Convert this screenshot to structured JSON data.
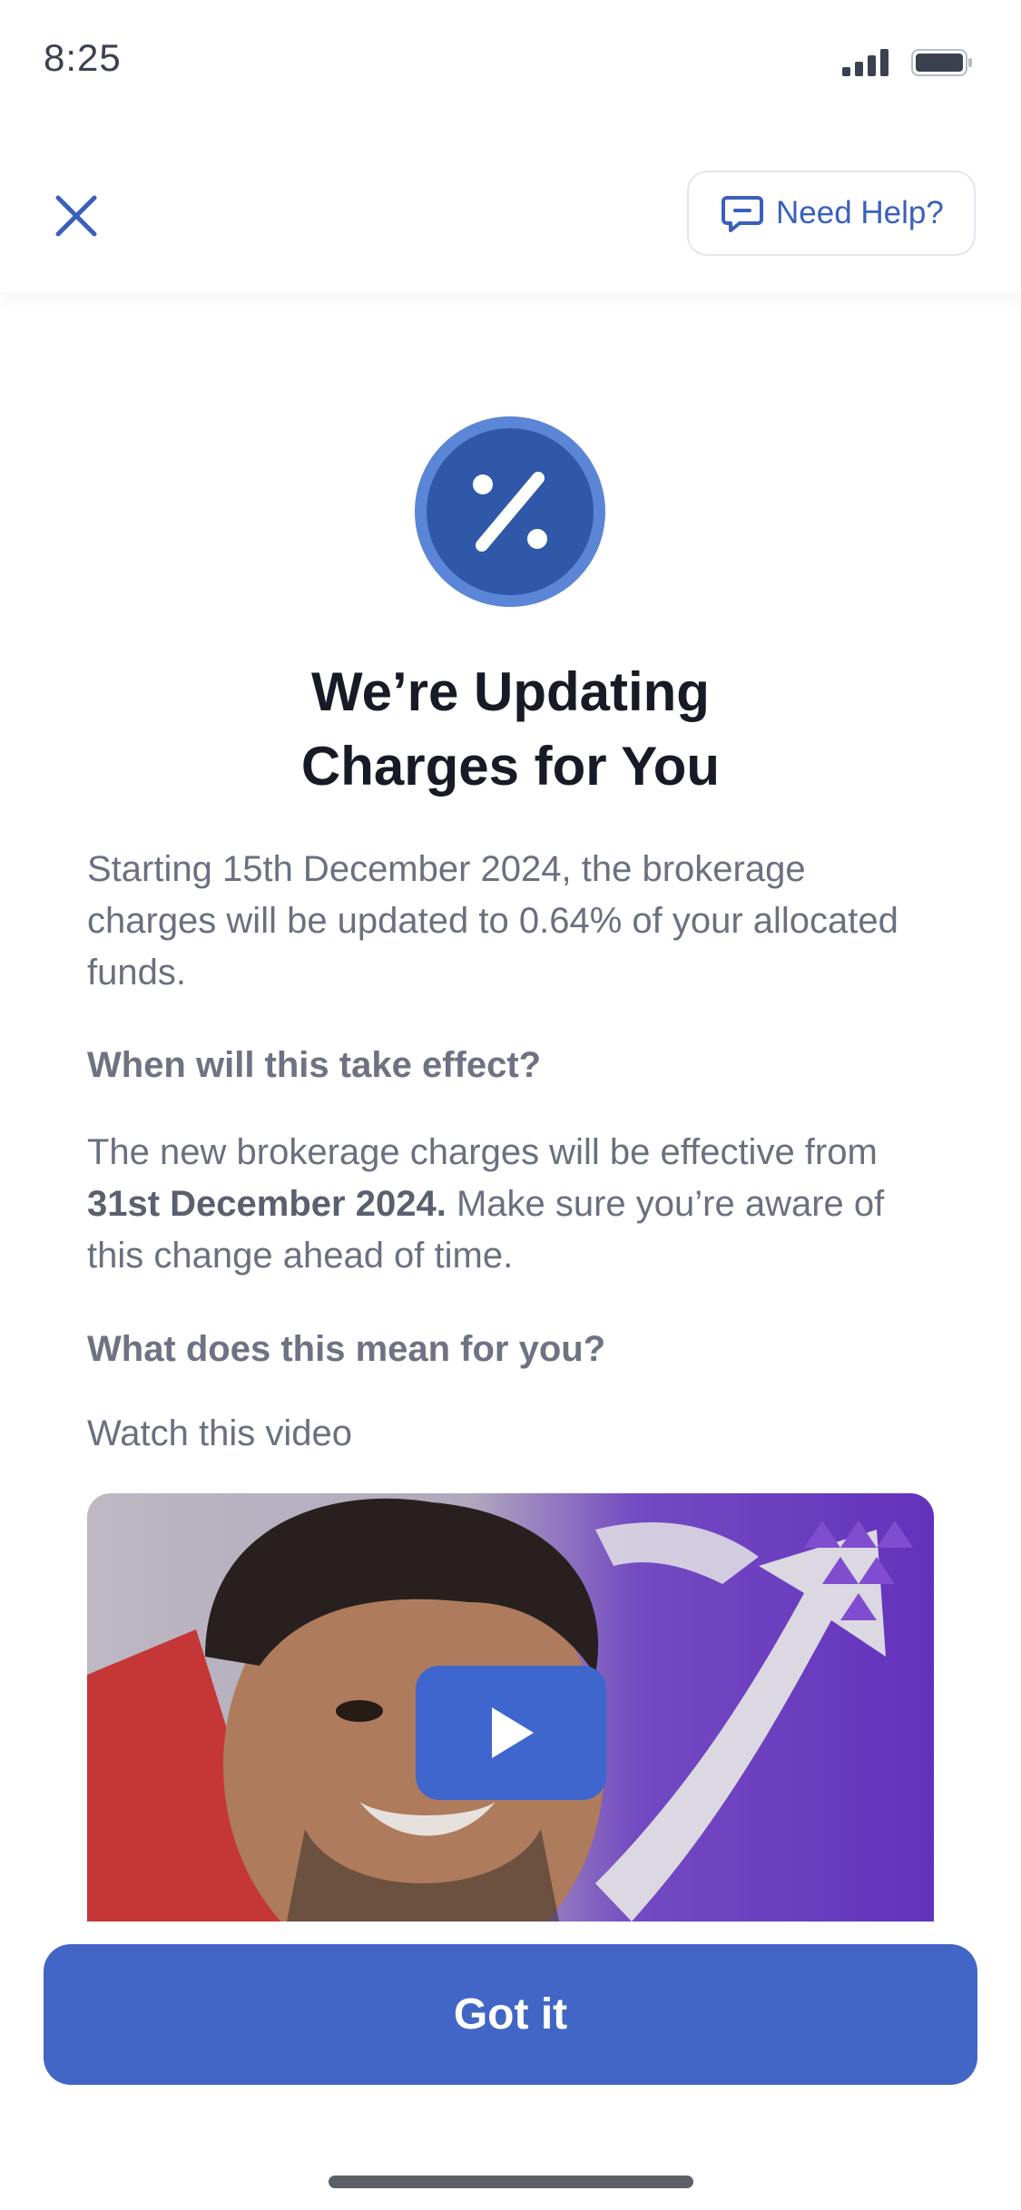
{
  "status_bar": {
    "time": "8:25"
  },
  "header": {
    "help_label": "Need Help?"
  },
  "colors": {
    "accent": "#4266c6",
    "badge": "#2f58a8",
    "badge_ring": "#5b85d6"
  },
  "icons": {
    "close": "close-icon",
    "help": "chat-help-icon",
    "badge": "percent-icon",
    "play": "play-icon"
  },
  "content": {
    "title_line1": "We’re Updating",
    "title_line2": "Charges for You",
    "intro": "Starting 15th December 2024, the brokerage charges will be updated to 0.64% of your allocated funds.",
    "effect_heading": "When will this take effect?",
    "effect_text_pre": "The new brokerage charges will be effective from ",
    "effect_date": "31st December 2024.",
    "effect_text_post": " Make sure you’re aware of this change ahead of time.",
    "mean_heading": "What does this mean for you?",
    "watch_label": "Watch this video"
  },
  "cta": {
    "label": "Got it"
  }
}
